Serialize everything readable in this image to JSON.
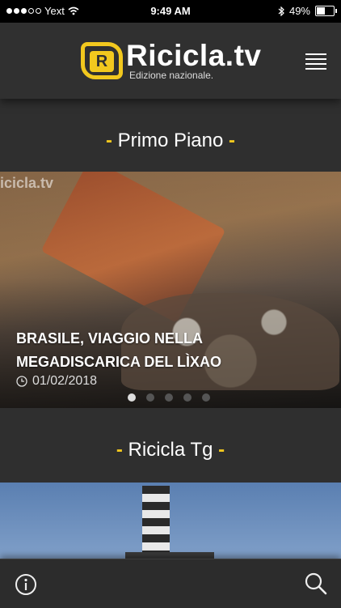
{
  "status_bar": {
    "carrier": "Yext",
    "time": "9:49 AM",
    "battery_percent": "49%",
    "battery_level": 0.49,
    "signal_bars_filled": 3,
    "signal_bars_total": 5
  },
  "header": {
    "logo_mark": "R",
    "logo_title": "Ricicla.tv",
    "logo_subtitle": "Edizione nazionale."
  },
  "sections": {
    "primo_piano": {
      "title": "Primo Piano"
    },
    "ricicla_tg": {
      "title": "Ricicla Tg"
    },
    "accent": "-"
  },
  "carousel": {
    "watermark": "icicla.tv",
    "headline": "BRASILE, VIAGGIO NELLA MEGADISCARICA DEL LÌXAO",
    "date": "01/02/2018",
    "pages_total": 5,
    "active_page": 1
  },
  "colors": {
    "brand_yellow": "#f2c81e",
    "background": "#2f2f2f"
  },
  "icons": {
    "info": "info-circle-icon",
    "search": "search-icon",
    "menu": "hamburger-menu-icon",
    "clock": "clock-icon"
  }
}
